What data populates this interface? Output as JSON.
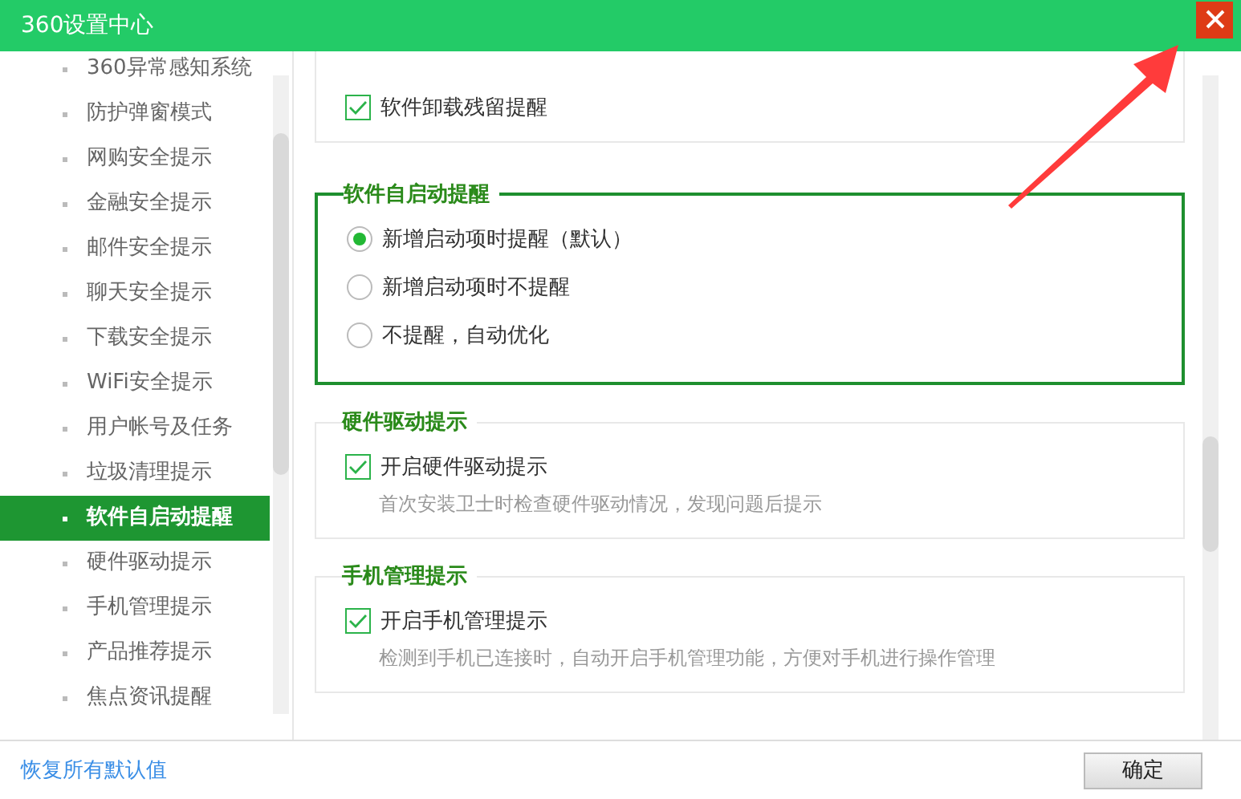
{
  "window": {
    "title": "360设置中心"
  },
  "sidebar": {
    "items": [
      {
        "label": "360异常感知系统",
        "selected": false
      },
      {
        "label": "防护弹窗模式",
        "selected": false
      },
      {
        "label": "网购安全提示",
        "selected": false
      },
      {
        "label": "金融安全提示",
        "selected": false
      },
      {
        "label": "邮件安全提示",
        "selected": false
      },
      {
        "label": "聊天安全提示",
        "selected": false
      },
      {
        "label": "下载安全提示",
        "selected": false
      },
      {
        "label": "WiFi安全提示",
        "selected": false
      },
      {
        "label": "用户帐号及任务",
        "selected": false
      },
      {
        "label": "垃圾清理提示",
        "selected": false
      },
      {
        "label": "软件自启动提醒",
        "selected": true
      },
      {
        "label": "硬件驱动提示",
        "selected": false
      },
      {
        "label": "手机管理提示",
        "selected": false
      },
      {
        "label": "产品推荐提示",
        "selected": false
      },
      {
        "label": "焦点资讯提醒",
        "selected": false
      }
    ]
  },
  "sections": [
    {
      "kind": "checkbox",
      "highlighted": false,
      "options": [
        {
          "label": "软件卸载残留提醒",
          "checked": true
        }
      ]
    },
    {
      "kind": "radio",
      "title": "软件自启动提醒",
      "highlighted": true,
      "options": [
        {
          "label": "新增启动项时提醒（默认）",
          "selected": true
        },
        {
          "label": "新增启动项时不提醒",
          "selected": false
        },
        {
          "label": "不提醒，自动优化",
          "selected": false
        }
      ]
    },
    {
      "kind": "checkbox",
      "title": "硬件驱动提示",
      "highlighted": false,
      "options": [
        {
          "label": "开启硬件驱动提示",
          "checked": true
        }
      ],
      "description": "首次安装卫士时检查硬件驱动情况，发现问题后提示"
    },
    {
      "kind": "checkbox",
      "title": "手机管理提示",
      "highlighted": false,
      "options": [
        {
          "label": "开启手机管理提示",
          "checked": true
        }
      ],
      "description": "检测到手机已连接时，自动开启手机管理功能，方便对手机进行操作管理"
    }
  ],
  "footer": {
    "reset_link": "恢复所有默认值",
    "ok_button": "确定"
  }
}
